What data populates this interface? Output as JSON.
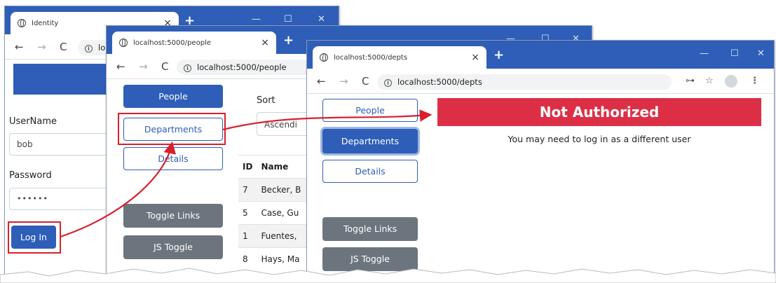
{
  "colors": {
    "titlebar": "#2e5eb7",
    "primary": "#2e5eb7",
    "secondary": "#6c757d",
    "danger": "#dc2f45",
    "callout": "#d8202c"
  },
  "window1": {
    "tab_title": "Identity",
    "url_visible": "lo",
    "form": {
      "username_label": "UserName",
      "username_value": "bob",
      "password_label": "Password",
      "password_value": "••••••",
      "login_button": "Log In"
    }
  },
  "window2": {
    "tab_title": "localhost:5000/people",
    "url": "localhost:5000/people",
    "nav": {
      "people": "People",
      "departments": "Departments",
      "details": "Details"
    },
    "toggle_links": "Toggle Links",
    "js_toggle": "JS Toggle",
    "sort_label": "Sort",
    "sort_value": "Ascendi",
    "table": {
      "headers": [
        "ID",
        "Name"
      ],
      "rows": [
        [
          "7",
          "Becker, B"
        ],
        [
          "5",
          "Case, Gu"
        ],
        [
          "1",
          "Fuentes,"
        ],
        [
          "8",
          "Hays, Ma"
        ]
      ]
    }
  },
  "window3": {
    "tab_title": "localhost:5000/depts",
    "url": "localhost:5000/depts",
    "nav": {
      "people": "People",
      "departments": "Departments",
      "details": "Details"
    },
    "toggle_links": "Toggle Links",
    "js_toggle": "JS Toggle",
    "banner": "Not Authorized",
    "message": "You may need to log in as a different user"
  },
  "browser_glyphs": {
    "back": "←",
    "forward": "→",
    "reload": "C",
    "new_tab": "+",
    "close_tab": "×",
    "minimize": "—",
    "maximize": "☐",
    "close": "✕",
    "key": "⊶",
    "star": "☆",
    "menu": "⋮"
  },
  "icons": [
    "globe-icon",
    "info-icon",
    "key-icon",
    "star-icon",
    "profile-icon",
    "menu-icon"
  ]
}
